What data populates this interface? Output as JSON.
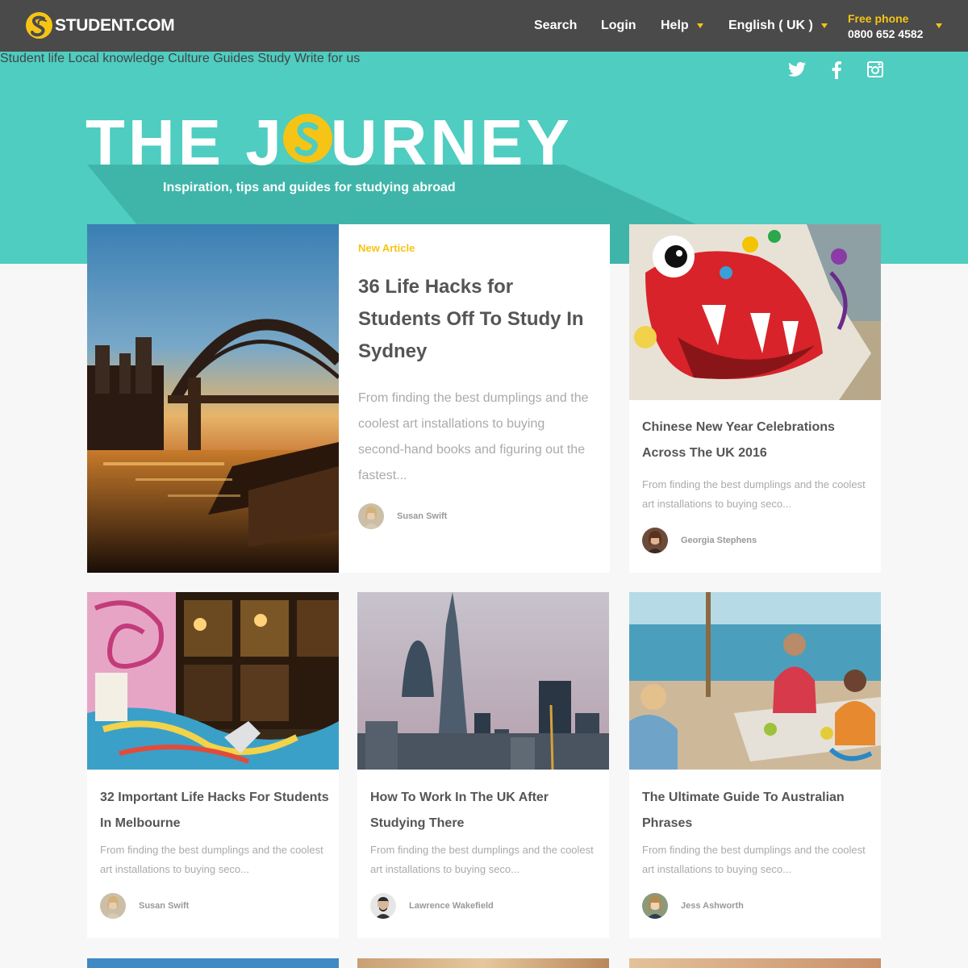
{
  "header": {
    "logo_text": "STUDENT.COM",
    "nav": {
      "search": "Search",
      "login": "Login",
      "help": "Help",
      "language": "English ( UK )"
    },
    "phone_label": "Free phone",
    "phone_number": "0800 652 4582"
  },
  "subnav": {
    "items": [
      "Student life",
      "Local knowledge",
      "Culture",
      "Guides",
      "Study",
      "Write for us"
    ]
  },
  "social": [
    "twitter-icon",
    "facebook-icon",
    "instagram-icon"
  ],
  "hero": {
    "title_before": "THE J",
    "title_after": "URNEY",
    "subtitle": "Inspiration, tips and guides for studying abroad"
  },
  "featured": {
    "badge": "New Article",
    "title": "36 Life Hacks for Students Off To Study In Sydney",
    "excerpt": "From finding the best dumplings and the coolest art installations to buying second-hand books and figuring out the fastest...",
    "author": "Susan Swift"
  },
  "articles": [
    {
      "title": "Chinese New Year Celebrations Across The UK 2016",
      "excerpt": "From finding the best dumplings and the coolest art installations to buying seco...",
      "author": "Georgia Stephens"
    },
    {
      "title": "32 Important Life Hacks For Students In Melbourne",
      "excerpt": "From finding the best dumplings and the coolest art installations to buying seco...",
      "author": "Susan Swift"
    },
    {
      "title": "How To Work In The UK After Studying There",
      "excerpt": "From finding the best dumplings and the coolest art installations to buying seco...",
      "author": "Lawrence Wakefield"
    },
    {
      "title": "The Ultimate Guide To Australian Phrases",
      "excerpt": "From finding the best dumplings and the coolest art installations to buying seco...",
      "author": "Jess Ashworth"
    }
  ],
  "colors": {
    "accent_yellow": "#f6c414",
    "hero_teal": "#4ecdc0",
    "topbar": "#4a4a4a"
  }
}
